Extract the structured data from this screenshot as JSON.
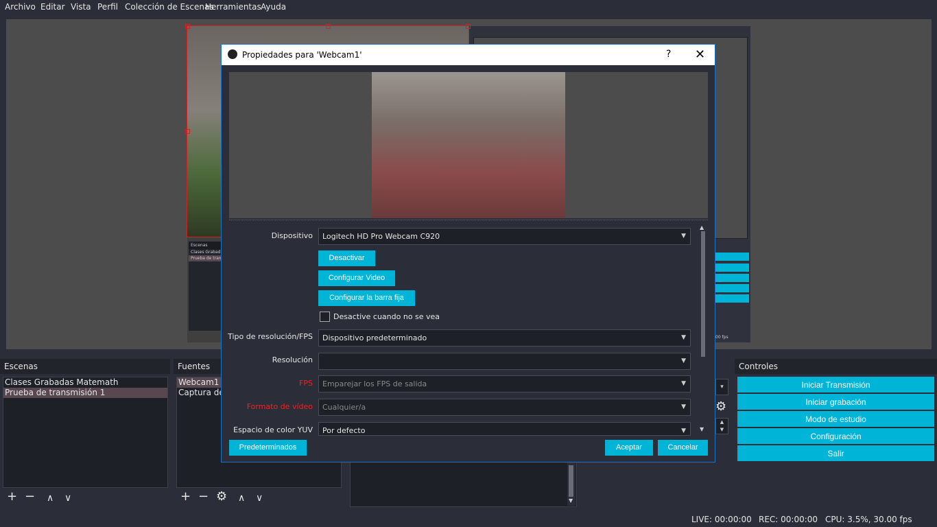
{
  "menubar": {
    "items": [
      "Archivo",
      "Editar",
      "Vista",
      "Perfil",
      "Colección de Escenas",
      "Herramientas",
      "Ayuda"
    ]
  },
  "scenes": {
    "title": "Escenas",
    "items": [
      "Clases Grabadas Matemath",
      "Prueba de transmisión 1"
    ],
    "selected_index": 1
  },
  "sources": {
    "title": "Fuentes",
    "items": [
      "Webcam1",
      "Captura de p"
    ]
  },
  "controls": {
    "title": "Controles",
    "buttons": [
      "Iniciar Transmisión",
      "Iniciar grabación",
      "Modo de estudio",
      "Configuración",
      "Salir"
    ]
  },
  "status": {
    "live": "LIVE: 00:00:00",
    "rec": "REC: 00:00:00",
    "cpu": "CPU: 3.5%, 30.00 fps"
  },
  "mini_preview": {
    "scenes_label": "Escenas",
    "items": [
      "Clases Grabada",
      "Prueba de transr"
    ],
    "fps_text": "00 fps"
  },
  "dialog": {
    "title": "Propiedades para 'Webcam1'",
    "help": "?",
    "close": "✕",
    "device_label": "Dispositivo",
    "device_value": "Logitech HD Pro Webcam C920",
    "btn_deactivate": "Desactivar",
    "btn_config_video": "Configurar Video",
    "btn_config_bar": "Configurar la barra fija",
    "checkbox_label": "Desactive cuando no se vea",
    "res_type_label": "Tipo de resolución/FPS",
    "res_type_value": "Dispositivo predeterminado",
    "resolution_label": "Resolución",
    "resolution_value": "",
    "fps_label": "FPS",
    "fps_value": "Emparejar los FPS de salida",
    "format_label": "Formato de vídeo",
    "format_value": "Cualquier/a",
    "yuv_label": "Espacio de color YUV",
    "yuv_value": "Por defecto",
    "btn_defaults": "Predeterminados",
    "btn_accept": "Aceptar",
    "btn_cancel": "Cancelar"
  },
  "colors": {
    "accent": "#00b4d8",
    "selection": "#58474e",
    "warning_label": "#e22222",
    "background": "#2b2e38"
  }
}
